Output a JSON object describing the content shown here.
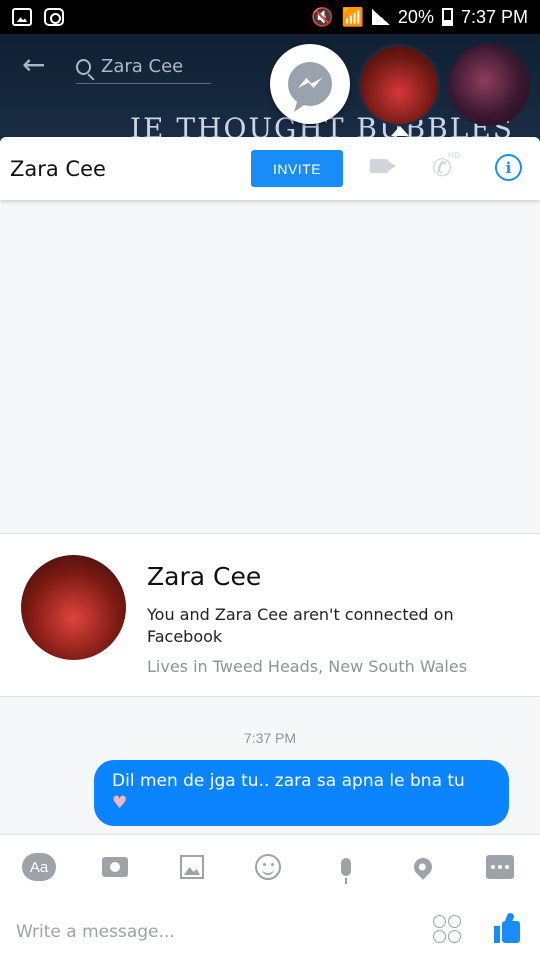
{
  "status_bar": {
    "battery": "20%",
    "time": "7:37 PM"
  },
  "top_bar": {
    "search_value": "Zara Cee",
    "cover_text": "IE THOUGHT BUBBLES"
  },
  "conversation": {
    "contact_name": "Zara Cee",
    "invite_label": "INVITE"
  },
  "profile_card": {
    "name": "Zara Cee",
    "description": "You and Zara Cee aren't connected on Facebook",
    "location": "Lives in Tweed Heads, New South Wales"
  },
  "messages": {
    "timestamp": "7:37 PM",
    "items": [
      {
        "text": "Dil men de jga tu.. zara sa apna le bna tu",
        "emoji": "♥"
      }
    ]
  },
  "composer": {
    "aa_label": "Aa",
    "placeholder": "Write a message..."
  },
  "colors": {
    "accent": "#1a8cf7",
    "bubble": "#0b84ff",
    "icon_gray": "#9ea3a9"
  }
}
